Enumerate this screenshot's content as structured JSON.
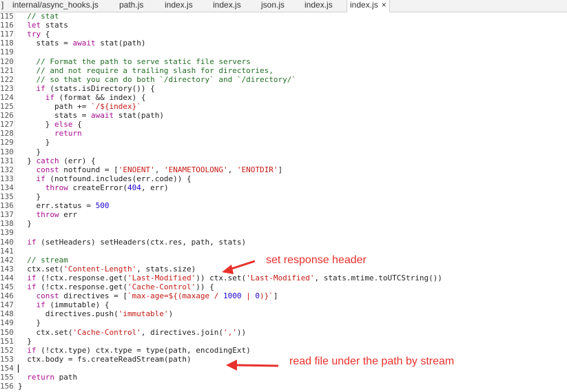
{
  "tabs": [
    {
      "label": "internal/async_hooks.js",
      "active": false
    },
    {
      "label": "path.js",
      "active": false
    },
    {
      "label": "index.js",
      "active": false
    },
    {
      "label": "index.js",
      "active": false
    },
    {
      "label": "json.js",
      "active": false
    },
    {
      "label": "index.js",
      "active": false
    },
    {
      "label": "index.js",
      "active": true,
      "close": "×"
    }
  ],
  "lines": [
    {
      "num": "115",
      "segs": [
        [
          "  ",
          "t"
        ],
        [
          "// stat",
          "cm"
        ]
      ]
    },
    {
      "num": "116",
      "segs": [
        [
          "  ",
          "t"
        ],
        [
          "let",
          "kw"
        ],
        [
          " stats",
          "t"
        ]
      ]
    },
    {
      "num": "117",
      "segs": [
        [
          "  ",
          "t"
        ],
        [
          "try",
          "kw"
        ],
        [
          " {",
          "t"
        ]
      ]
    },
    {
      "num": "118",
      "segs": [
        [
          "    stats = ",
          "t"
        ],
        [
          "await",
          "kw"
        ],
        [
          " stat(path)",
          "t"
        ]
      ]
    },
    {
      "num": "119",
      "segs": []
    },
    {
      "num": "120",
      "segs": [
        [
          "    ",
          "t"
        ],
        [
          "// Format the path to serve static file servers",
          "cm"
        ]
      ]
    },
    {
      "num": "121",
      "segs": [
        [
          "    ",
          "t"
        ],
        [
          "// and not require a trailing slash for directories,",
          "cm"
        ]
      ]
    },
    {
      "num": "122",
      "segs": [
        [
          "    ",
          "t"
        ],
        [
          "// so that you can do both `/directory` and `/directory/`",
          "cm"
        ]
      ]
    },
    {
      "num": "123",
      "segs": [
        [
          "    ",
          "t"
        ],
        [
          "if",
          "kw"
        ],
        [
          " (stats.isDirectory()) {",
          "t"
        ]
      ]
    },
    {
      "num": "124",
      "segs": [
        [
          "      ",
          "t"
        ],
        [
          "if",
          "kw"
        ],
        [
          " (format && index) {",
          "t"
        ]
      ]
    },
    {
      "num": "125",
      "segs": [
        [
          "        path += ",
          "t"
        ],
        [
          "`/${index}`",
          "str"
        ]
      ]
    },
    {
      "num": "126",
      "segs": [
        [
          "        stats = ",
          "t"
        ],
        [
          "await",
          "kw"
        ],
        [
          " stat(path)",
          "t"
        ]
      ]
    },
    {
      "num": "127",
      "segs": [
        [
          "      } ",
          "t"
        ],
        [
          "else",
          "kw"
        ],
        [
          " {",
          "t"
        ]
      ]
    },
    {
      "num": "128",
      "segs": [
        [
          "        ",
          "t"
        ],
        [
          "return",
          "kw"
        ]
      ]
    },
    {
      "num": "129",
      "segs": [
        [
          "      }",
          "t"
        ]
      ]
    },
    {
      "num": "130",
      "segs": [
        [
          "    }",
          "t"
        ]
      ]
    },
    {
      "num": "131",
      "segs": [
        [
          "  } ",
          "t"
        ],
        [
          "catch",
          "kw"
        ],
        [
          " (err) {",
          "t"
        ]
      ]
    },
    {
      "num": "132",
      "segs": [
        [
          "    ",
          "t"
        ],
        [
          "const",
          "kw"
        ],
        [
          " notfound = [",
          "t"
        ],
        [
          "'ENOENT'",
          "str"
        ],
        [
          ", ",
          "t"
        ],
        [
          "'ENAMETOOLONG'",
          "str"
        ],
        [
          ", ",
          "t"
        ],
        [
          "'ENOTDIR'",
          "str"
        ],
        [
          "]",
          "t"
        ]
      ]
    },
    {
      "num": "133",
      "segs": [
        [
          "    ",
          "t"
        ],
        [
          "if",
          "kw"
        ],
        [
          " (notfound.includes(err.code)) {",
          "t"
        ]
      ]
    },
    {
      "num": "134",
      "segs": [
        [
          "      ",
          "t"
        ],
        [
          "throw",
          "kw"
        ],
        [
          " createError(",
          "t"
        ],
        [
          "404",
          "num"
        ],
        [
          ", err)",
          "t"
        ]
      ]
    },
    {
      "num": "135",
      "segs": [
        [
          "    }",
          "t"
        ]
      ]
    },
    {
      "num": "136",
      "segs": [
        [
          "    err.status = ",
          "t"
        ],
        [
          "500",
          "num"
        ]
      ]
    },
    {
      "num": "137",
      "segs": [
        [
          "    ",
          "t"
        ],
        [
          "throw",
          "kw"
        ],
        [
          " err",
          "t"
        ]
      ]
    },
    {
      "num": "138",
      "segs": [
        [
          "  }",
          "t"
        ]
      ]
    },
    {
      "num": "139",
      "segs": []
    },
    {
      "num": "140",
      "segs": [
        [
          "  ",
          "t"
        ],
        [
          "if",
          "kw"
        ],
        [
          " (setHeaders) setHeaders(ctx.res, path, stats)",
          "t"
        ]
      ]
    },
    {
      "num": "141",
      "segs": []
    },
    {
      "num": "142",
      "segs": [
        [
          "  ",
          "t"
        ],
        [
          "// stream",
          "cm"
        ]
      ]
    },
    {
      "num": "143",
      "segs": [
        [
          "  ctx.set(",
          "t"
        ],
        [
          "'Content-Length'",
          "str"
        ],
        [
          ", stats.size)",
          "t"
        ]
      ]
    },
    {
      "num": "144",
      "segs": [
        [
          "  ",
          "t"
        ],
        [
          "if",
          "kw"
        ],
        [
          " (!ctx.response.get(",
          "t"
        ],
        [
          "'Last-Modified'",
          "str"
        ],
        [
          ")) ctx.set(",
          "t"
        ],
        [
          "'Last-Modified'",
          "str"
        ],
        [
          ", stats.mtime.toUTCString())",
          "t"
        ]
      ]
    },
    {
      "num": "145",
      "segs": [
        [
          "  ",
          "t"
        ],
        [
          "if",
          "kw"
        ],
        [
          " (!ctx.response.get(",
          "t"
        ],
        [
          "'Cache-Control'",
          "str"
        ],
        [
          ")) {",
          "t"
        ]
      ]
    },
    {
      "num": "146",
      "segs": [
        [
          "    ",
          "t"
        ],
        [
          "const",
          "kw"
        ],
        [
          " directives = [",
          "t"
        ],
        [
          "`max-age=${(maxage / ",
          "str"
        ],
        [
          "1000",
          "num"
        ],
        [
          " | ",
          "str"
        ],
        [
          "0",
          "num"
        ],
        [
          ")}`",
          "str"
        ],
        [
          "]",
          "t"
        ]
      ]
    },
    {
      "num": "147",
      "segs": [
        [
          "    ",
          "t"
        ],
        [
          "if",
          "kw"
        ],
        [
          " (immutable) {",
          "t"
        ]
      ]
    },
    {
      "num": "148",
      "segs": [
        [
          "      directives.push(",
          "t"
        ],
        [
          "'immutable'",
          "str"
        ],
        [
          ")",
          "t"
        ]
      ]
    },
    {
      "num": "149",
      "segs": [
        [
          "    }",
          "t"
        ]
      ]
    },
    {
      "num": "150",
      "segs": [
        [
          "    ctx.set(",
          "t"
        ],
        [
          "'Cache-Control'",
          "str"
        ],
        [
          ", directives.join(",
          "t"
        ],
        [
          "','",
          "str"
        ],
        [
          "))",
          "t"
        ]
      ]
    },
    {
      "num": "151",
      "segs": [
        [
          "  }",
          "t"
        ]
      ]
    },
    {
      "num": "152",
      "segs": [
        [
          "  ",
          "t"
        ],
        [
          "if",
          "kw"
        ],
        [
          " (!ctx.type) ctx.type = type(path, encodingExt)",
          "t"
        ]
      ]
    },
    {
      "num": "153",
      "segs": [
        [
          "  ctx.body = fs.createReadStream(path)",
          "t"
        ]
      ]
    },
    {
      "num": "154",
      "segs": [],
      "cursor": true
    },
    {
      "num": "155",
      "segs": [
        [
          "  ",
          "t"
        ],
        [
          "return",
          "kw"
        ],
        [
          " path",
          "t"
        ]
      ]
    },
    {
      "num": "156",
      "segs": [
        [
          "}",
          "t"
        ]
      ]
    }
  ],
  "annotations": {
    "first": "set response header",
    "second": "read file under the path by stream",
    "color": "#e8312c"
  }
}
